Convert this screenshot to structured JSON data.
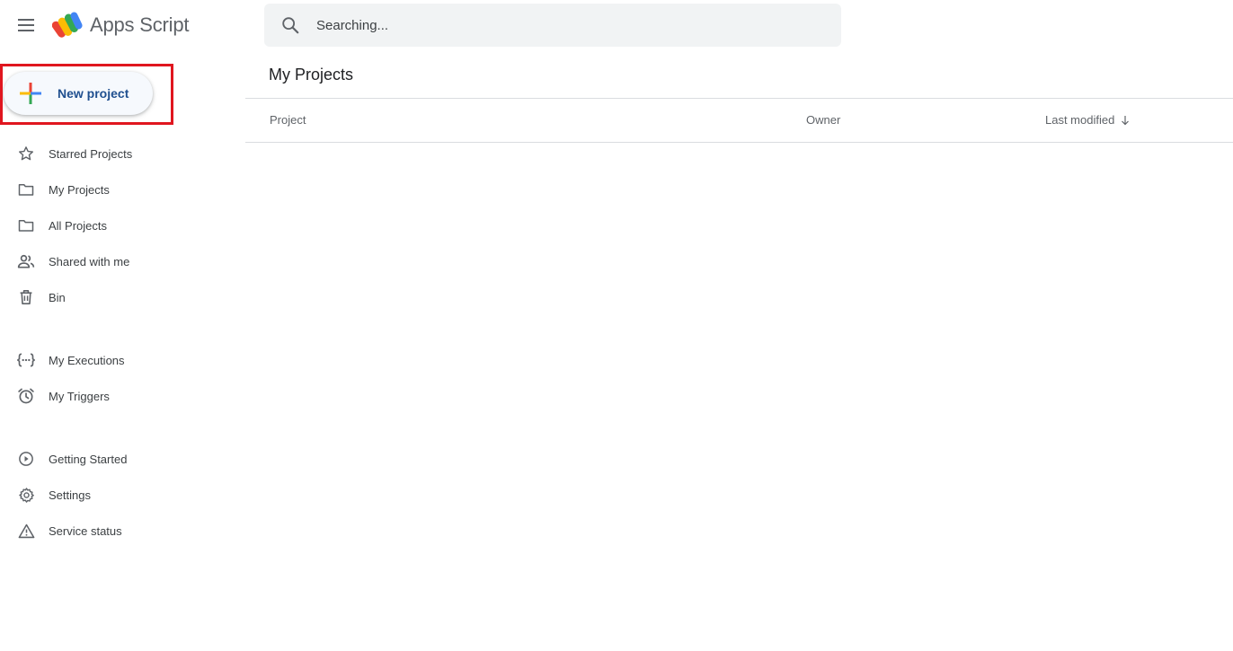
{
  "header": {
    "app_title": "Apps Script",
    "search_placeholder": "Searching..."
  },
  "sidebar": {
    "new_project_label": "New project",
    "nav_groups": [
      [
        {
          "label": "Starred Projects",
          "icon": "star-icon"
        },
        {
          "label": "My Projects",
          "icon": "folder-icon"
        },
        {
          "label": "All Projects",
          "icon": "folder-icon"
        },
        {
          "label": "Shared with me",
          "icon": "people-icon"
        },
        {
          "label": "Bin",
          "icon": "trash-icon"
        }
      ],
      [
        {
          "label": "My Executions",
          "icon": "executions-icon"
        },
        {
          "label": "My Triggers",
          "icon": "alarm-icon"
        }
      ],
      [
        {
          "label": "Getting Started",
          "icon": "play-circle-icon"
        },
        {
          "label": "Settings",
          "icon": "gear-icon"
        },
        {
          "label": "Service status",
          "icon": "warning-icon"
        }
      ]
    ]
  },
  "main": {
    "title": "My Projects",
    "columns": {
      "project": "Project",
      "owner": "Owner",
      "last_modified": "Last modified"
    },
    "rows": []
  },
  "colors": {
    "highlight": "#e0161f",
    "accent_text": "#1f4f8f",
    "search_bg": "#f1f3f4"
  }
}
